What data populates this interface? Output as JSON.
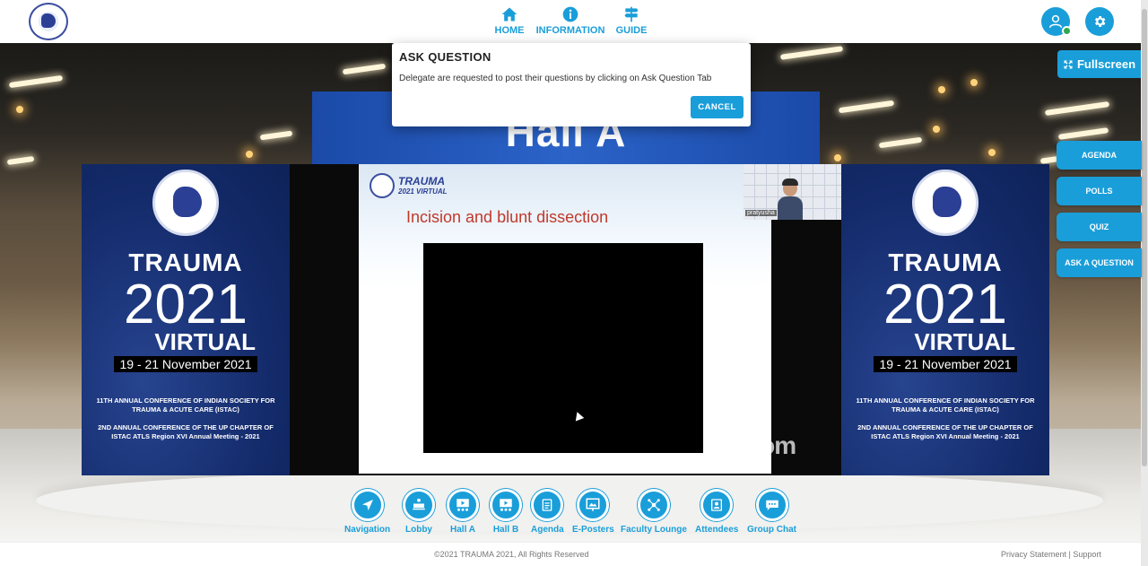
{
  "header": {
    "nav": [
      {
        "label": "HOME",
        "icon": "home-icon"
      },
      {
        "label": "INFORMATION",
        "icon": "info-icon"
      },
      {
        "label": "GUIDE",
        "icon": "signpost-icon"
      }
    ]
  },
  "dialog": {
    "title": "ASK QUESTION",
    "message": "Delegate are requested to post their questions by clicking on Ask Question Tab",
    "cancel_label": "CANCEL"
  },
  "hall": {
    "sign": "Hall A"
  },
  "banner": {
    "title": "TRAUMA",
    "year": "2021",
    "subtitle": "VIRTUAL",
    "dates": "19 - 21 November 2021",
    "line1": "11TH ANNUAL CONFERENCE OF INDIAN SOCIETY FOR TRAUMA & ACUTE CARE (ISTAC)",
    "line2": "2ND ANNUAL CONFERENCE OF THE UP CHAPTER OF ISTAC ATLS Region XVI Annual Meeting - 2021"
  },
  "screen": {
    "brand": "TRAUMA",
    "brand_sub": "2021 VIRTUAL",
    "slide_title": "Incision and blunt dissection",
    "speaker_name": "pratyusha",
    "watermark": "zoom"
  },
  "sidebar": {
    "fullscreen_label": "Fullscreen",
    "buttons": [
      "AGENDA",
      "POLLS",
      "QUIZ",
      "ASK A QUESTION"
    ]
  },
  "bottom_nav": [
    {
      "label": "Navigation",
      "icon": "navigation-icon"
    },
    {
      "label": "Lobby",
      "icon": "lobby-icon"
    },
    {
      "label": "Hall A",
      "icon": "hall-a-icon"
    },
    {
      "label": "Hall B",
      "icon": "hall-b-icon"
    },
    {
      "label": "Agenda",
      "icon": "agenda-icon"
    },
    {
      "label": "E-Posters",
      "icon": "poster-icon"
    },
    {
      "label": "Faculty Lounge",
      "icon": "network-icon"
    },
    {
      "label": "Attendees",
      "icon": "attendees-icon"
    },
    {
      "label": "Group Chat",
      "icon": "chat-icon"
    }
  ],
  "footer": {
    "copyright": "©2021 TRAUMA 2021, All Rights Reserved",
    "privacy": "Privacy Statement",
    "separator": "|",
    "support": "Support"
  },
  "colors": {
    "accent": "#1a9ed9",
    "banner_blue": "#142b6b",
    "online": "#2fa84f"
  }
}
